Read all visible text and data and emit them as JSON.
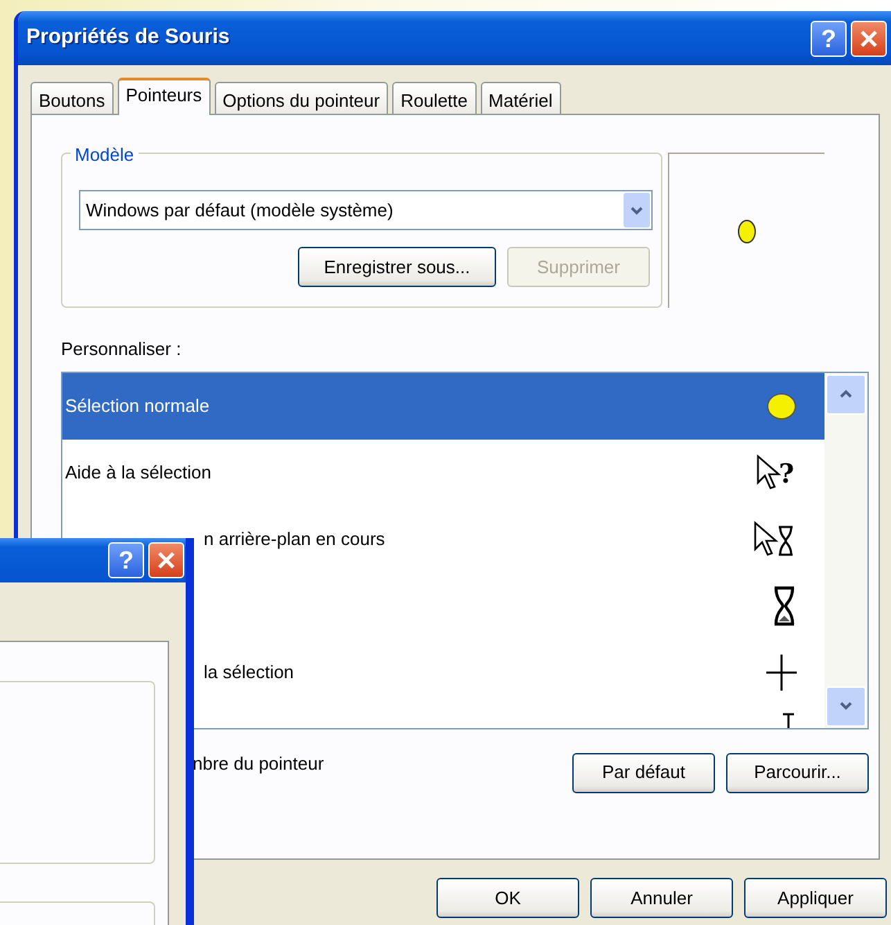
{
  "window": {
    "title": "Propriétés de Souris",
    "help_label": "?"
  },
  "tabs": [
    {
      "label": "Boutons",
      "selected": false
    },
    {
      "label": "Pointeurs",
      "selected": true
    },
    {
      "label": "Options du pointeur",
      "selected": false
    },
    {
      "label": "Roulette",
      "selected": false
    },
    {
      "label": "Matériel",
      "selected": false
    }
  ],
  "scheme": {
    "legend": "Modèle",
    "value": "Windows par défaut (modèle système)",
    "buttons": [
      {
        "label": "Enregistrer sous...",
        "disabled": false
      },
      {
        "label": "Supprimer",
        "disabled": true
      }
    ]
  },
  "customize": {
    "label": "Personnaliser :",
    "rows": [
      {
        "text": "Sélection normale",
        "kind": "dot",
        "selected": true,
        "covered": false
      },
      {
        "text": "Aide à la sélection",
        "kind": "help",
        "glyph": "?",
        "selected": false,
        "covered": false
      },
      {
        "text": "n arrière-plan en cours",
        "kind": "working",
        "selected": false,
        "covered": true
      },
      {
        "kind": "busy",
        "selected": false
      },
      {
        "text": "la sélection",
        "kind": "cross",
        "selected": false,
        "covered": true
      },
      {
        "kind": "text",
        "selected": false
      }
    ]
  },
  "shadow_text": "nbre du pointeur",
  "pointer_buttons": [
    {
      "label": "Par défaut"
    },
    {
      "label": "Parcourir..."
    }
  ],
  "footer_buttons": [
    {
      "label": "OK"
    },
    {
      "label": "Annuler"
    },
    {
      "label": "Appliquer"
    }
  ],
  "other_window": {
    "help_label": "?"
  }
}
